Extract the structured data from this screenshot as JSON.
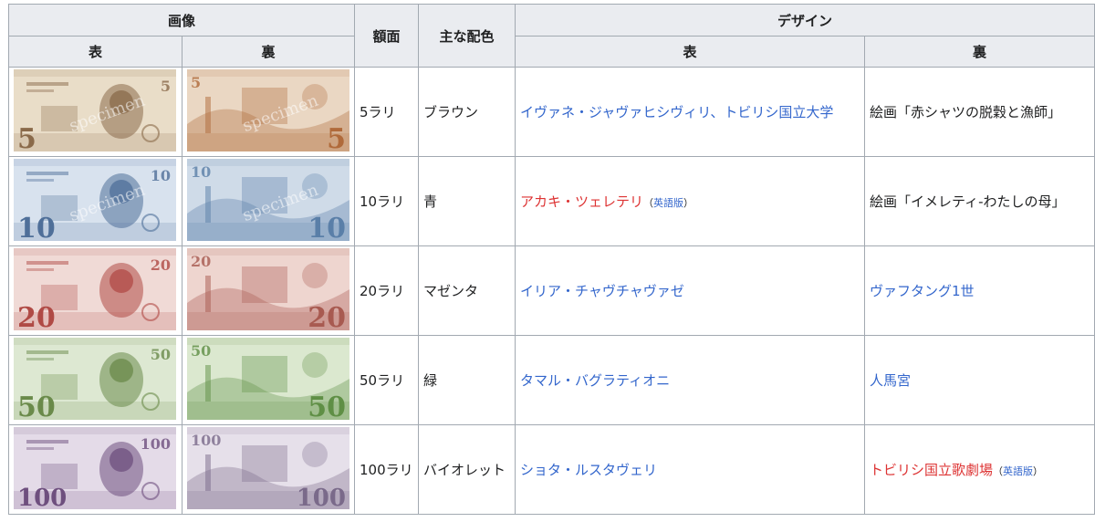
{
  "header": {
    "images": "画像",
    "front": "表",
    "back": "裏",
    "denomination": "額面",
    "main_color": "主な配色",
    "design": "デザイン",
    "design_front": "表",
    "design_back": "裏"
  },
  "rows": [
    {
      "denom": "5ラリ",
      "color": "ブラウン",
      "front_text": "イヴァネ・ジャヴァヒシヴィリ、トビリシ国立大学",
      "front_link": true,
      "back_text": "絵画「赤シャツの脱穀と漁師」",
      "back_link": false,
      "note_num": "5",
      "note_front_bg": "#e9ddc8",
      "note_front_accent": "#8a6a4a",
      "note_back_bg": "#ead7c3",
      "note_back_accent": "#b06a3a",
      "watermark": "specimen"
    },
    {
      "denom": "10ラリ",
      "color": "青",
      "front_text": "アカキ・ツェレテリ",
      "front_link": "red",
      "front_suffix_open": "（",
      "front_suffix": "英語版",
      "front_suffix_close": "）",
      "back_text": "絵画「イメレティ-わたしの母」",
      "back_link": false,
      "note_num": "10",
      "note_front_bg": "#d8e2ee",
      "note_front_accent": "#4f6f99",
      "note_back_bg": "#cfdbe8",
      "note_back_accent": "#5a7fa8",
      "watermark": "specimen"
    },
    {
      "denom": "20ラリ",
      "color": "マゼンタ",
      "front_text": "イリア・チャヴチャヴァゼ",
      "front_link": true,
      "back_text": "ヴァフタング1世",
      "back_link": true,
      "note_num": "20",
      "note_front_bg": "#f0dad6",
      "note_front_accent": "#b04a45",
      "note_back_bg": "#eed5cf",
      "note_back_accent": "#a85a50",
      "watermark": ""
    },
    {
      "denom": "50ラリ",
      "color": "緑",
      "front_text": "タマル・バグラティオニ",
      "front_link": true,
      "back_text": "人馬宮",
      "back_link": true,
      "note_num": "50",
      "note_front_bg": "#dde8d2",
      "note_front_accent": "#6a8a4a",
      "note_back_bg": "#dbe8cf",
      "note_back_accent": "#5f8f45",
      "watermark": ""
    },
    {
      "denom": "100ラリ",
      "color": "バイオレット",
      "front_text": "ショタ・ルスタヴェリ",
      "front_link": true,
      "back_text": "トビリシ国立歌劇場",
      "back_link": "red",
      "back_suffix_open": "（",
      "back_suffix": "英語版",
      "back_suffix_close": "）",
      "note_num": "100",
      "note_front_bg": "#e4dbe8",
      "note_front_accent": "#6e4f7e",
      "note_back_bg": "#e6e0ea",
      "note_back_accent": "#7a6a8a",
      "watermark": ""
    }
  ]
}
